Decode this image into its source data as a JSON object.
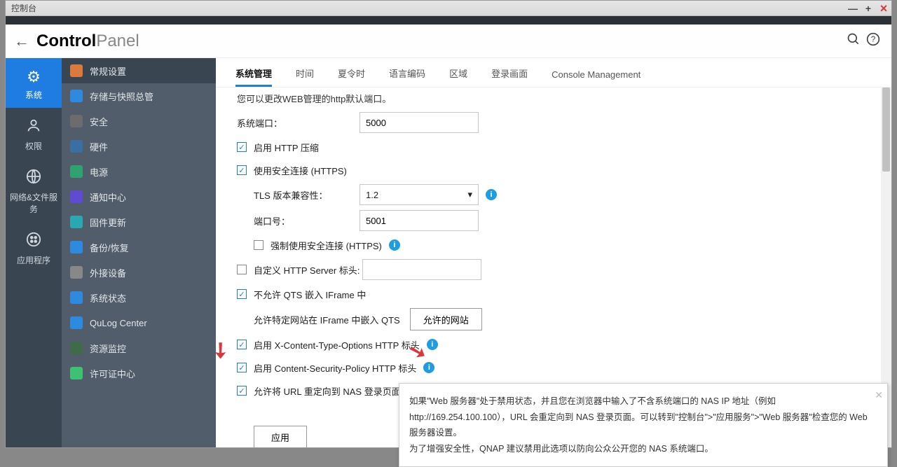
{
  "window_title": "控制台",
  "brand_strong": "Control",
  "brand_light": "Panel",
  "rail": [
    {
      "label": "系统",
      "icon": "⚙"
    },
    {
      "label": "权限",
      "icon": "👤"
    },
    {
      "label": "网络&文件服务",
      "icon": "🌐"
    },
    {
      "label": "应用程序",
      "icon": "⊞"
    }
  ],
  "sidebar": [
    {
      "label": "常规设置",
      "color": "#d97b3f"
    },
    {
      "label": "存储与快照总管",
      "color": "#2e8adf"
    },
    {
      "label": "安全",
      "color": "#6c6c6c"
    },
    {
      "label": "硬件",
      "color": "#3b6fa3"
    },
    {
      "label": "电源",
      "color": "#2fa36f"
    },
    {
      "label": "通知中心",
      "color": "#5e4bd1"
    },
    {
      "label": "固件更新",
      "color": "#2aa7b0"
    },
    {
      "label": "备份/恢复",
      "color": "#2e8adf"
    },
    {
      "label": "外接设备",
      "color": "#888"
    },
    {
      "label": "系统状态",
      "color": "#2e8adf"
    },
    {
      "label": "QuLog Center",
      "color": "#2e8adf"
    },
    {
      "label": "资源监控",
      "color": "#3f6b4a"
    },
    {
      "label": "许可证中心",
      "color": "#3fc174"
    }
  ],
  "tabs": [
    "系统管理",
    "时间",
    "夏令时",
    "语言编码",
    "区域",
    "登录画面",
    "Console Management"
  ],
  "truncated_line": "您可以更改WEB管理的http默认端口。",
  "form": {
    "system_port_label": "系统端口：",
    "system_port_value": "5000",
    "http_compress": "启用 HTTP 压缩",
    "https_enable": "使用安全连接 (HTTPS)",
    "tls_label": "TLS 版本兼容性：",
    "tls_value": "1.2",
    "port_label": "端口号：",
    "port_value": "5001",
    "force_https": "强制使用安全连接 (HTTPS)",
    "custom_header": "自定义 HTTP Server 标头:",
    "no_iframe": "不允许 QTS 嵌入 IFrame 中",
    "iframe_allow_label": "允许特定网站在 IFrame 中嵌入 QTS",
    "iframe_btn": "允许的网站",
    "xcto": "启用 X-Content-Type-Options HTTP 标头",
    "csp": "启用 Content-Security-Policy HTTP 标头",
    "redirect": "允许将 URL 重定向到 NAS 登录页面",
    "apply": "应用"
  },
  "tooltip": {
    "line1": "如果\"Web 服务器\"处于禁用状态，并且您在浏览器中输入了不含系统端口的 NAS IP 地址（例如 http://169.254.100.100），URL 会重定向到 NAS 登录页面。可以转到\"控制台\">\"应用服务\">\"Web 服务器\"检查您的 Web 服务器设置。",
    "line2": "为了增强安全性，QNAP 建议禁用此选项以防向公众公开您的 NAS 系统端口。"
  }
}
